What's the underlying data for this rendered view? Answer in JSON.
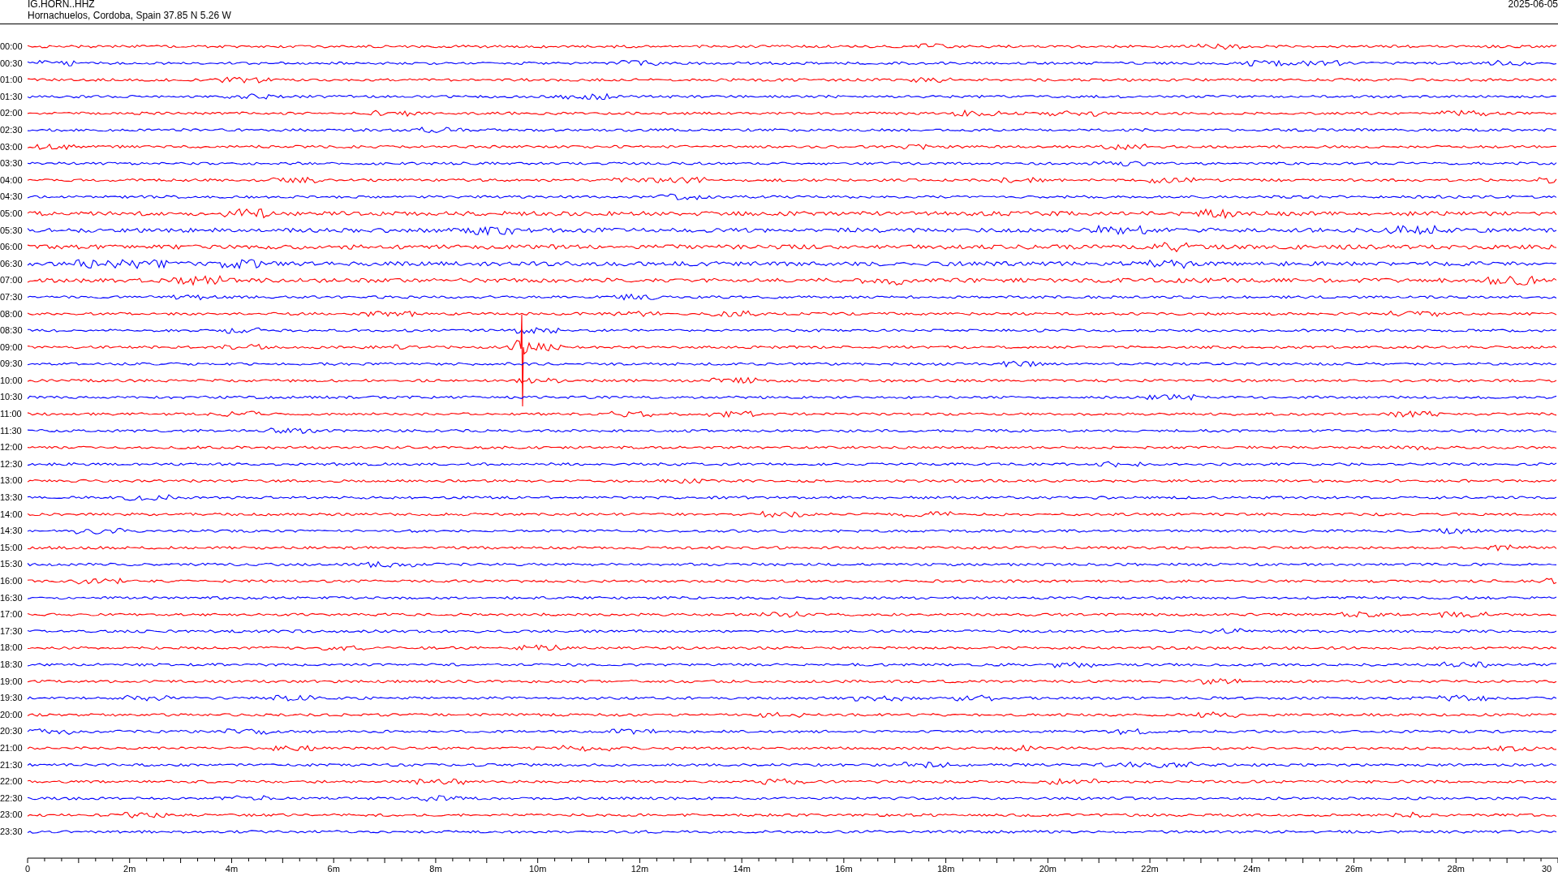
{
  "header": {
    "station": "IG.HORN..HHZ",
    "location": "Hornachuelos, Cordoba, Spain  37.85 N 5.26 W",
    "date": "2025-06-05"
  },
  "rows": [
    {
      "label": "00:00",
      "color": "#ff0000"
    },
    {
      "label": "00:30",
      "color": "#0000ff"
    },
    {
      "label": "01:00",
      "color": "#ff0000"
    },
    {
      "label": "01:30",
      "color": "#0000ff"
    },
    {
      "label": "02:00",
      "color": "#ff0000"
    },
    {
      "label": "02:30",
      "color": "#0000ff"
    },
    {
      "label": "03:00",
      "color": "#ff0000"
    },
    {
      "label": "03:30",
      "color": "#0000ff"
    },
    {
      "label": "04:00",
      "color": "#ff0000"
    },
    {
      "label": "04:30",
      "color": "#0000ff"
    },
    {
      "label": "05:00",
      "color": "#ff0000"
    },
    {
      "label": "05:30",
      "color": "#0000ff"
    },
    {
      "label": "06:00",
      "color": "#ff0000"
    },
    {
      "label": "06:30",
      "color": "#0000ff"
    },
    {
      "label": "07:00",
      "color": "#ff0000"
    },
    {
      "label": "07:30",
      "color": "#0000ff"
    },
    {
      "label": "08:00",
      "color": "#ff0000"
    },
    {
      "label": "08:30",
      "color": "#0000ff"
    },
    {
      "label": "09:00",
      "color": "#ff0000"
    },
    {
      "label": "09:30",
      "color": "#0000ff"
    },
    {
      "label": "10:00",
      "color": "#ff0000"
    },
    {
      "label": "10:30",
      "color": "#0000ff"
    },
    {
      "label": "11:00",
      "color": "#ff0000"
    },
    {
      "label": "11:30",
      "color": "#0000ff"
    },
    {
      "label": "12:00",
      "color": "#ff0000"
    },
    {
      "label": "12:30",
      "color": "#0000ff"
    },
    {
      "label": "13:00",
      "color": "#ff0000"
    },
    {
      "label": "13:30",
      "color": "#0000ff"
    },
    {
      "label": "14:00",
      "color": "#ff0000"
    },
    {
      "label": "14:30",
      "color": "#0000ff"
    },
    {
      "label": "15:00",
      "color": "#ff0000"
    },
    {
      "label": "15:30",
      "color": "#0000ff"
    },
    {
      "label": "16:00",
      "color": "#ff0000"
    },
    {
      "label": "16:30",
      "color": "#0000ff"
    },
    {
      "label": "17:00",
      "color": "#ff0000"
    },
    {
      "label": "17:30",
      "color": "#0000ff"
    },
    {
      "label": "18:00",
      "color": "#ff0000"
    },
    {
      "label": "18:30",
      "color": "#0000ff"
    },
    {
      "label": "19:00",
      "color": "#ff0000"
    },
    {
      "label": "19:30",
      "color": "#0000ff"
    },
    {
      "label": "20:00",
      "color": "#ff0000"
    },
    {
      "label": "20:30",
      "color": "#0000ff"
    },
    {
      "label": "21:00",
      "color": "#ff0000"
    },
    {
      "label": "21:30",
      "color": "#0000ff"
    },
    {
      "label": "22:00",
      "color": "#ff0000"
    },
    {
      "label": "22:30",
      "color": "#0000ff"
    },
    {
      "label": "23:00",
      "color": "#ff0000"
    },
    {
      "label": "23:30",
      "color": "#0000ff"
    }
  ],
  "axis": {
    "labels": [
      "0",
      "2m",
      "4m",
      "6m",
      "8m",
      "10m",
      "12m",
      "14m",
      "16m",
      "18m",
      "20m",
      "22m",
      "24m",
      "26m",
      "28m",
      "30"
    ]
  }
}
